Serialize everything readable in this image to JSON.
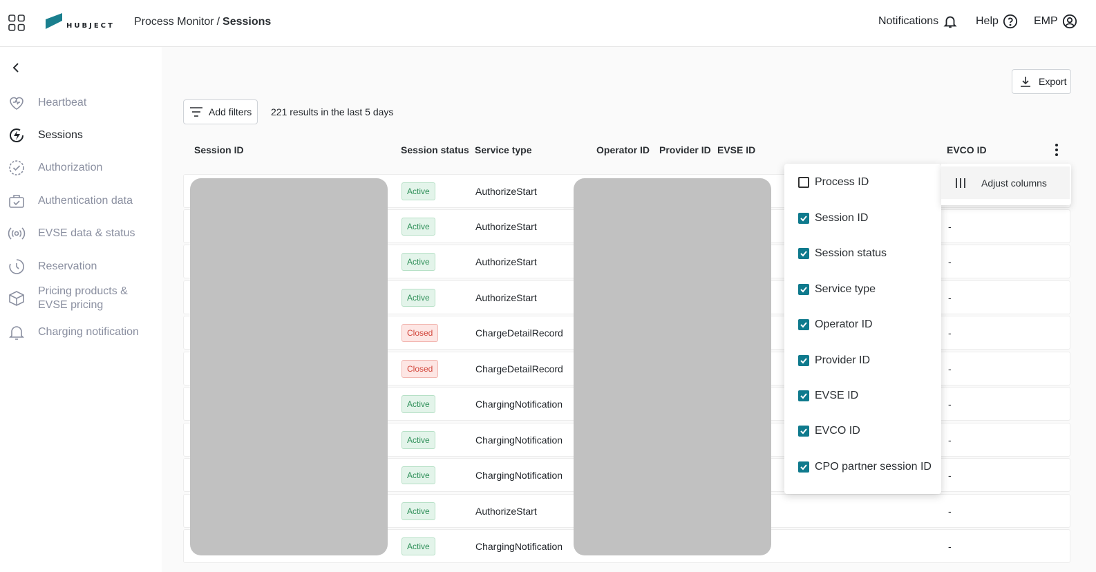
{
  "header": {
    "logo_text": "HUBJECT",
    "breadcrumb_parent": "Process Monitor",
    "breadcrumb_separator": "/",
    "breadcrumb_current": "Sessions",
    "notifications_label": "Notifications",
    "help_label": "Help",
    "user_label": "EMP"
  },
  "sidebar": {
    "items": [
      {
        "label": "Heartbeat",
        "icon": "heart-icon"
      },
      {
        "label": "Sessions",
        "icon": "bolt-icon",
        "active": true
      },
      {
        "label": "Authorization",
        "icon": "check-circle-icon"
      },
      {
        "label": "Authentication data",
        "icon": "briefcase-icon"
      },
      {
        "label": "EVSE data & status",
        "icon": "signal-icon"
      },
      {
        "label": "Reservation",
        "icon": "clock-icon"
      },
      {
        "label": "Pricing products & EVSE pricing",
        "label_line1": "Pricing products &",
        "label_line2": "EVSE pricing",
        "icon": "box-icon"
      },
      {
        "label": "Charging notification",
        "icon": "bell-icon"
      }
    ]
  },
  "toolbar": {
    "export_label": "Export",
    "add_filters_label": "Add filters",
    "results_text": "221 results in the last 5 days"
  },
  "table": {
    "columns": [
      "Session ID",
      "Session status",
      "Service type",
      "Operator ID",
      "Provider ID",
      "EVSE ID",
      "EVCO ID"
    ],
    "rows": [
      {
        "status": "Active",
        "service": "AuthorizeStart",
        "evco": ""
      },
      {
        "status": "Active",
        "service": "AuthorizeStart",
        "evco": "-"
      },
      {
        "status": "Active",
        "service": "AuthorizeStart",
        "evco": "-"
      },
      {
        "status": "Active",
        "service": "AuthorizeStart",
        "evco": "-"
      },
      {
        "status": "Closed",
        "service": "ChargeDetailRecord",
        "evco": "-"
      },
      {
        "status": "Closed",
        "service": "ChargeDetailRecord",
        "evco": "-"
      },
      {
        "status": "Active",
        "service": "ChargingNotification",
        "evco": "-"
      },
      {
        "status": "Active",
        "service": "ChargingNotification",
        "evco": "-"
      },
      {
        "status": "Active",
        "service": "ChargingNotification",
        "evco": "-"
      },
      {
        "status": "Active",
        "service": "AuthorizeStart",
        "evco": "-"
      },
      {
        "status": "Active",
        "service": "ChargingNotification",
        "evco": "-"
      }
    ]
  },
  "column_menu": {
    "options": [
      {
        "label": "Process ID",
        "checked": false
      },
      {
        "label": "Session ID",
        "checked": true
      },
      {
        "label": "Session status",
        "checked": true
      },
      {
        "label": "Service type",
        "checked": true
      },
      {
        "label": "Operator ID",
        "checked": true
      },
      {
        "label": "Provider ID",
        "checked": true
      },
      {
        "label": "EVSE ID",
        "checked": true
      },
      {
        "label": "EVCO ID",
        "checked": true
      },
      {
        "label": "CPO partner session ID",
        "checked": true
      }
    ],
    "adjust_columns_label": "Adjust columns"
  },
  "colors": {
    "accent": "#0f7a8d",
    "active_badge_bg": "#e3f4ea",
    "active_badge_text": "#2e8f58",
    "closed_badge_bg": "#fde6e4",
    "closed_badge_text": "#d2463b",
    "muted_nav": "#8a8fa0"
  }
}
